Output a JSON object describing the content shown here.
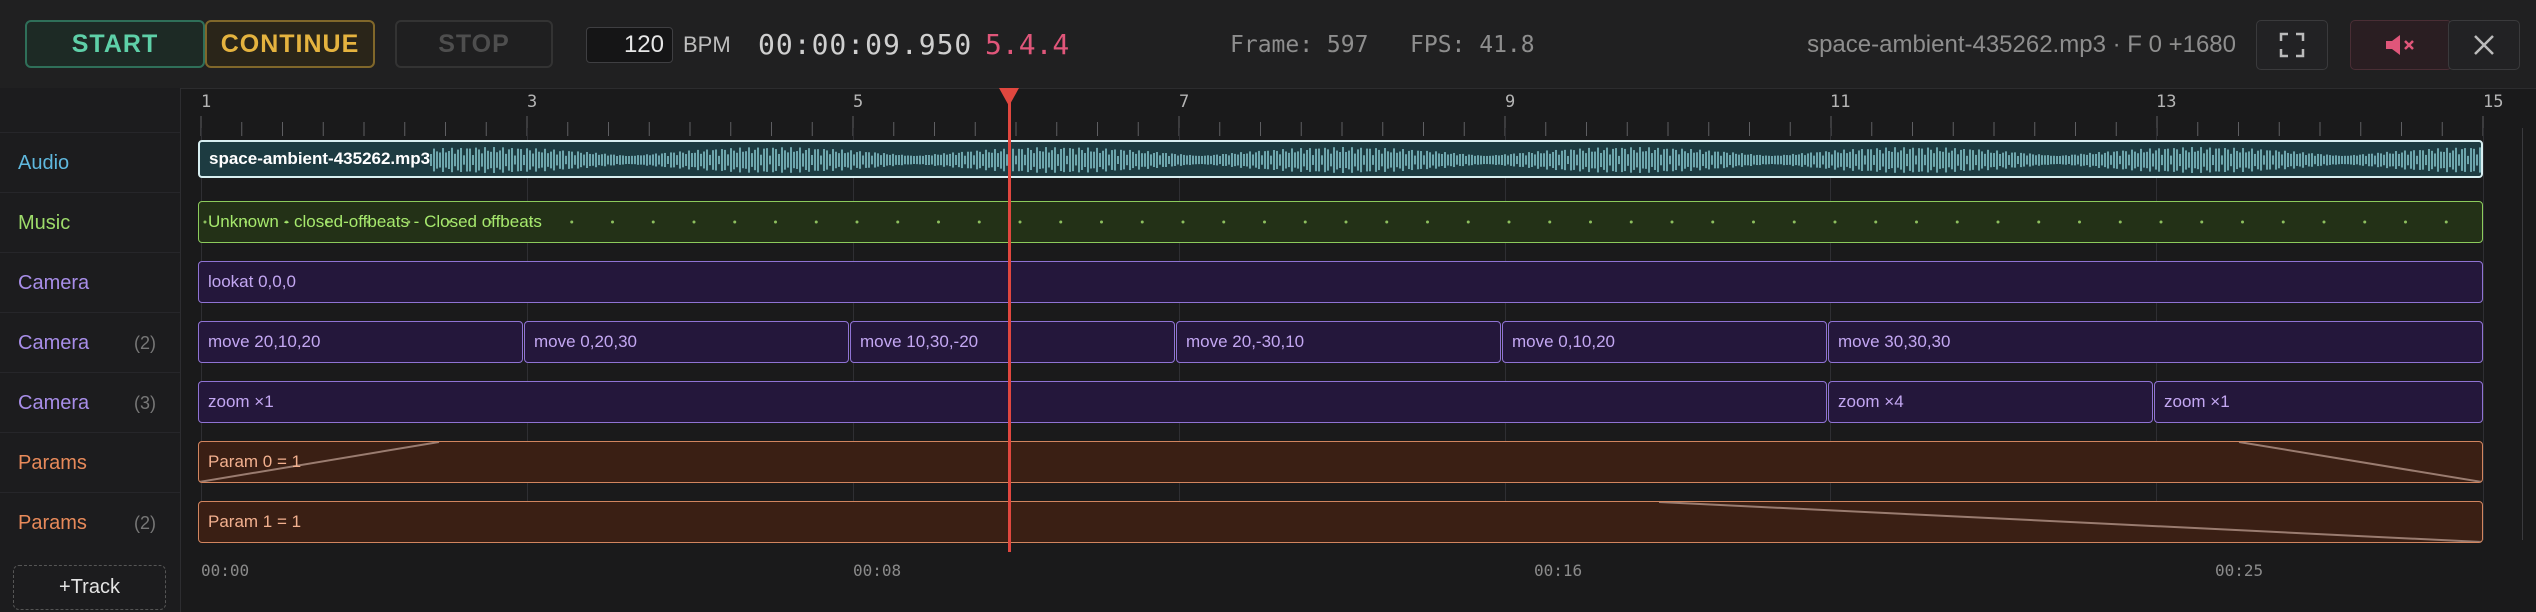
{
  "toolbar": {
    "start_label": "START",
    "continue_label": "CONTINUE",
    "stop_label": "STOP",
    "bpm_value": "120",
    "bpm_label": "BPM",
    "time": "00:00:09.950",
    "position": "5.4.4",
    "frame": "Frame: 597",
    "fps": "FPS: 41.8",
    "file_info": "space-ambient-435262.mp3 · F 0 +1680",
    "icons": [
      "fullscreen-icon",
      "mute-icon",
      "close-icon"
    ]
  },
  "ruler": {
    "numbers": [
      "1",
      "3",
      "5",
      "7",
      "9",
      "11",
      "13",
      "15"
    ]
  },
  "tracks": [
    {
      "label": "Audio",
      "sub": "",
      "color": "#5fb8de"
    },
    {
      "label": "Music",
      "sub": "",
      "color": "#9ddb6a"
    },
    {
      "label": "Camera",
      "sub": "",
      "color": "#a88ee8"
    },
    {
      "label": "Camera",
      "sub": "(2)",
      "color": "#a88ee8"
    },
    {
      "label": "Camera",
      "sub": "(3)",
      "color": "#a88ee8"
    },
    {
      "label": "Params",
      "sub": "",
      "color": "#e88a5a"
    },
    {
      "label": "Params",
      "sub": "(2)",
      "color": "#e88a5a"
    }
  ],
  "clips": {
    "audio": "space-ambient-435262.mp3",
    "music": "Unknown - closed-offbeats - Closed offbeats",
    "camera1": [
      "lookat 0,0,0"
    ],
    "camera2": [
      "move  20,10,20",
      "move  0,20,30",
      "move  10,30,-20",
      "move  20,-30,10",
      "move  0,10,20",
      "move  30,30,30"
    ],
    "camera3": [
      "zoom  ×1",
      "zoom  ×4",
      "zoom  ×1"
    ],
    "params1": "Param 0 = 1",
    "params2": "Param 1 = 1"
  },
  "footer_times": [
    "00:00",
    "00:08",
    "00:16",
    "00:25"
  ],
  "add_track_label": "+Track"
}
